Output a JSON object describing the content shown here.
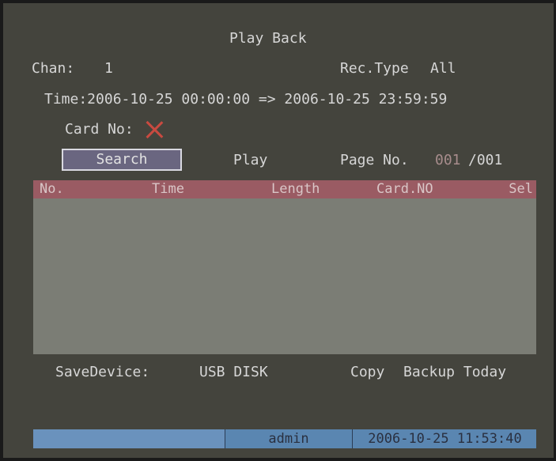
{
  "header": {
    "title": "Play Back"
  },
  "filters": {
    "chan_label": "Chan:",
    "chan_value": "1",
    "rectype_label": "Rec.Type",
    "rectype_value": "All",
    "time_range": "Time:2006-10-25 00:00:00 => 2006-10-25 23:59:59",
    "card_label": "Card No:"
  },
  "actions": {
    "search_label": "Search",
    "play_label": "Play",
    "page_label": "Page No.",
    "page_current": "001",
    "page_total": "/001"
  },
  "table": {
    "columns": [
      "No.",
      "Time",
      "Length",
      "Card.NO",
      "Sel"
    ],
    "rows": []
  },
  "footer": {
    "savedevice_label": "SaveDevice:",
    "savedevice_value": "USB DISK",
    "copy_label": "Copy",
    "backup_label": "Backup Today"
  },
  "status_bar": {
    "user": "admin",
    "datetime": "2006-10-25 11:53:40"
  },
  "colors": {
    "background": "#44443d",
    "table_header": "#9a5b63",
    "table_body": "#7b7d75",
    "status_bar": "#5a86b1",
    "card_x": "#c94a40"
  },
  "icons": {
    "card_status": "close-icon"
  }
}
